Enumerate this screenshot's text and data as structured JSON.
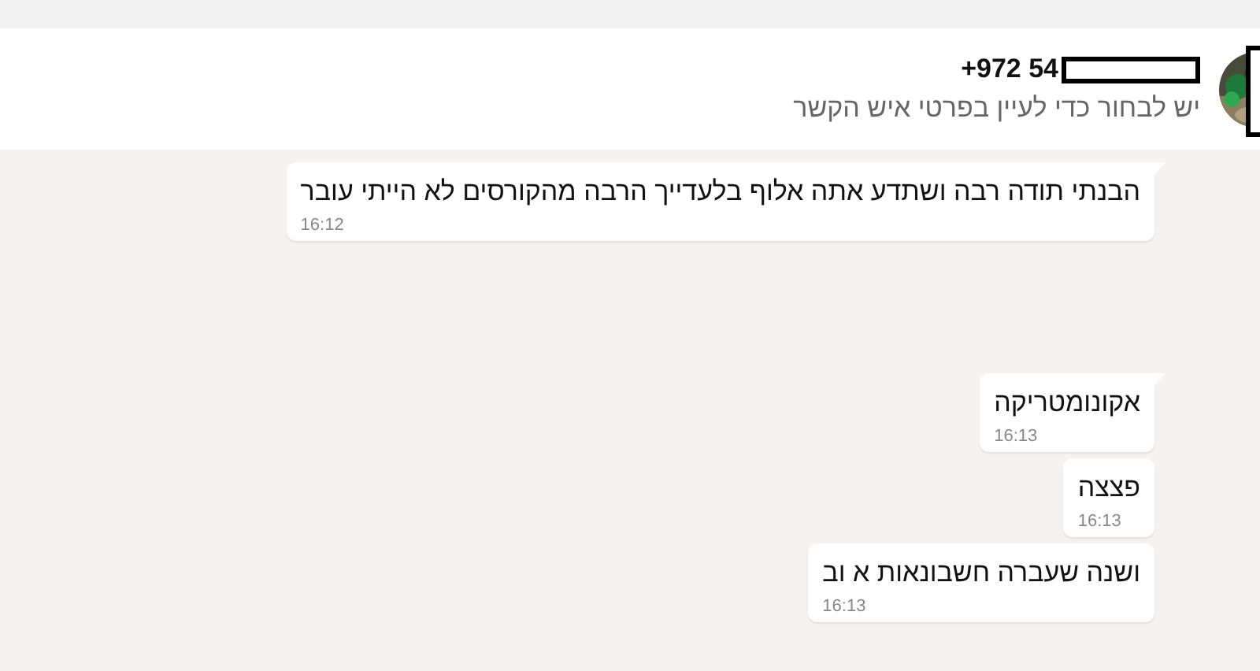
{
  "header": {
    "contact_name": "+972 54",
    "subtitle": "יש לבחור כדי לעיין בפרטי איש הקשר"
  },
  "groups": [
    {
      "messages": [
        {
          "text": "הבנתי תודה רבה ושתדע אתה אלוף בלעדייך הרבה מהקורסים לא הייתי עובר",
          "time": "16:12"
        }
      ]
    },
    {
      "messages": [
        {
          "text": "אקונומטריקה",
          "time": "16:13"
        },
        {
          "text": "פצצה",
          "time": "16:13"
        },
        {
          "text": "ושנה שעברה חשבונאות א וב",
          "time": "16:13"
        }
      ]
    }
  ]
}
